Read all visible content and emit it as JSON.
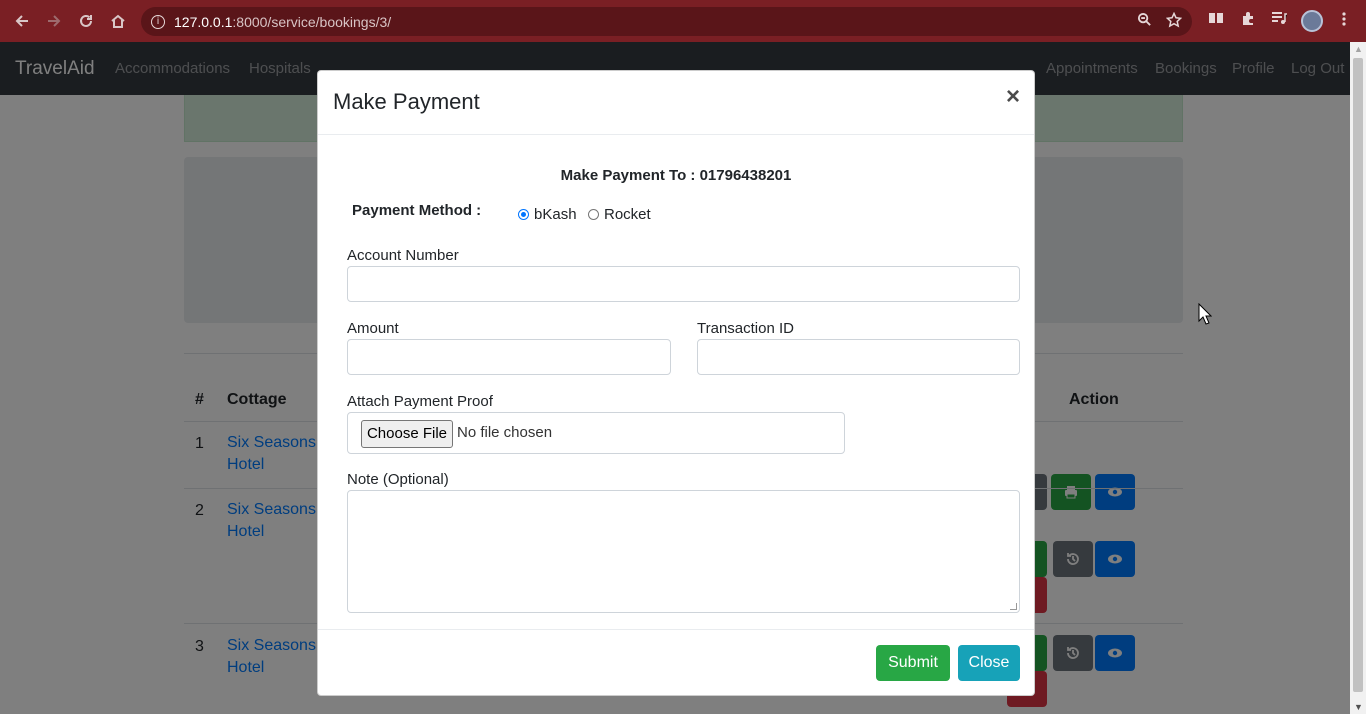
{
  "browser": {
    "url_host": "127.0.0.1",
    "url_path": ":8000/service/bookings/3/"
  },
  "navbar": {
    "brand": "TravelAid",
    "left_links": [
      "Accommodations",
      "Hospitals"
    ],
    "right_links": [
      "Appointments",
      "Bookings",
      "Profile",
      "Log Out"
    ]
  },
  "table": {
    "headers": [
      "#",
      "Cottage",
      "Action"
    ],
    "rows": [
      {
        "num": "1",
        "cottage_line1": "Six Seasons",
        "cottage_line2": "Hotel"
      },
      {
        "num": "2",
        "cottage_line1": "Six Seasons",
        "cottage_line2": "Hotel"
      },
      {
        "num": "3",
        "cottage_line1": "Six Seasons",
        "cottage_line2": "Hotel"
      }
    ]
  },
  "modal": {
    "title": "Make Payment",
    "close_symbol": "×",
    "pay_to_label": "Make Payment To : ",
    "pay_to_number": "01796438201",
    "payment_method_label": "Payment Method :",
    "payment_methods": [
      "bKash",
      "Rocket"
    ],
    "selected_method": "bKash",
    "account_number_label": "Account Number",
    "account_number_value": "",
    "amount_label": "Amount",
    "amount_value": "",
    "transaction_id_label": "Transaction ID",
    "transaction_id_value": "",
    "attach_label": "Attach Payment Proof",
    "file_button": "Choose File",
    "file_status": "No file chosen",
    "note_label": "Note (Optional)",
    "note_value": "",
    "submit_label": "Submit",
    "close_label": "Close"
  },
  "colors": {
    "navbar_bg": "#343a40",
    "submit": "#28a745",
    "close": "#17a2b8",
    "link": "#007bff"
  },
  "icons": {
    "back": "arrow-left-icon",
    "forward": "arrow-right-icon",
    "reload": "reload-icon",
    "home": "home-icon",
    "print": "print-icon",
    "view": "eye-icon",
    "history": "history-icon"
  }
}
